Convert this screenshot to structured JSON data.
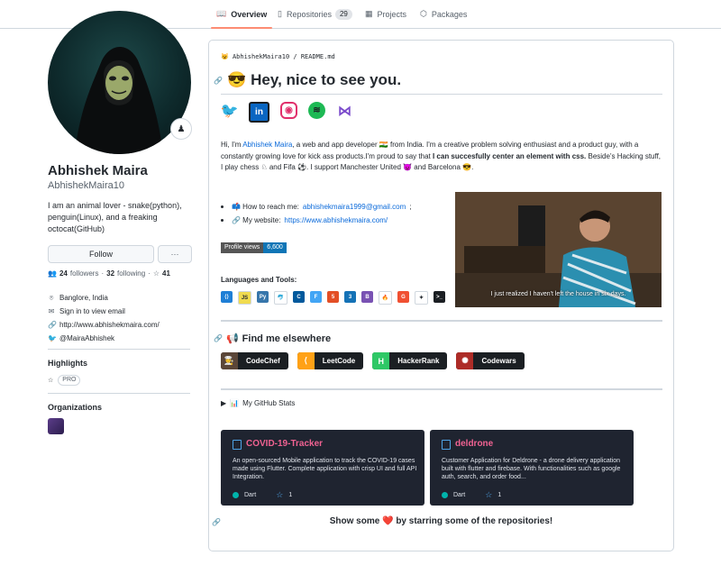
{
  "tabs": [
    {
      "label": "Overview",
      "icon": "book-icon"
    },
    {
      "label": "Repositories",
      "icon": "repo-icon",
      "count": "29"
    },
    {
      "label": "Projects",
      "icon": "project-icon"
    },
    {
      "label": "Packages",
      "icon": "package-icon"
    }
  ],
  "profile": {
    "name": "Abhishek Maira",
    "login": "AbhishekMaira10",
    "bio": "I am an animal lover - snake(python), penguin(Linux), and a freaking octocat(GitHub)",
    "follow_label": "Follow",
    "more_label": "···",
    "followers": "24",
    "followers_label": "followers",
    "following": "32",
    "following_label": "following",
    "stars": "41",
    "location": "Banglore, India",
    "email": "Sign in to view email",
    "website": "http://www.abhishekmaira.com/",
    "twitter": "@MairaAbhishek"
  },
  "highlights": {
    "title": "Highlights",
    "pro_label": "PRO"
  },
  "organizations": {
    "title": "Organizations"
  },
  "readme": {
    "path_user": "AbhishekMaira10",
    "path_sep": "/",
    "path_file": "README.md",
    "heading_emoji": "😎",
    "heading": "Hey, nice to see you.",
    "socials": [
      "twitter-icon",
      "linkedin-icon",
      "instagram-icon",
      "spotify-icon",
      "visualstudio-icon"
    ],
    "intro_1": "Hi, I'm ",
    "intro_name": "Abhishek Maira",
    "intro_2": ", a web and app developer 🇮🇳 from India. I'm a creative problem solving enthusiast and a product guy, with a constantly growing love for kick ass products.I'm proud to say that ",
    "intro_bold": "I can succesfully center an element with css.",
    "intro_3": " Beside's Hacking stuff, I play chess ♘ and Fifa ⚽. I support Manchester United 😈 and Barcelona 😎.",
    "reach_label": "📫 How to reach me: ",
    "reach_email": "abhishekmaira1999@gmail.com",
    "reach_end": ";",
    "website_label": "🔗 My website: ",
    "website_url": "https://www.abhishekmaira.com/",
    "views_label": "Profile views",
    "views_count": "6,600",
    "gif_caption": "I just realized I haven't left the house in six days.",
    "tools_title": "Languages and Tools:",
    "tools": [
      {
        "icon": "vscode-icon",
        "text": "⟨⟩",
        "color": "#1f7fd6"
      },
      {
        "icon": "javascript-icon",
        "text": "JS",
        "color": "#f0db4f"
      },
      {
        "icon": "python-icon",
        "text": "Py",
        "color": "#3776ab"
      },
      {
        "icon": "mysql-icon",
        "text": "🐬",
        "color": "#ffffff"
      },
      {
        "icon": "cplusplus-icon",
        "text": "C",
        "color": "#00599c"
      },
      {
        "icon": "flutter-icon",
        "text": "F",
        "color": "#42a5f5"
      },
      {
        "icon": "html5-icon",
        "text": "5",
        "color": "#e34f26"
      },
      {
        "icon": "css3-icon",
        "text": "3",
        "color": "#1572b6"
      },
      {
        "icon": "bootstrap-icon",
        "text": "B",
        "color": "#7952b3"
      },
      {
        "icon": "firebase-icon",
        "text": "🔥",
        "color": "#ffffff"
      },
      {
        "icon": "git-icon",
        "text": "G",
        "color": "#f05032"
      },
      {
        "icon": "figma-icon",
        "text": "✦",
        "color": "#ffffff"
      },
      {
        "icon": "terminal-icon",
        "text": ">_",
        "color": "#1b1f23"
      }
    ],
    "find_emoji": "📢",
    "find_title": "Find me elsewhere",
    "badges": [
      {
        "label": "CodeChef",
        "icon": "codechef-icon",
        "color": "#5b4638",
        "glyph": "👨‍🍳"
      },
      {
        "label": "LeetCode",
        "icon": "leetcode-icon",
        "color": "#ffa116",
        "glyph": "⟨"
      },
      {
        "label": "HackerRank",
        "icon": "hackerrank-icon",
        "color": "#2ec866",
        "glyph": "H"
      },
      {
        "label": "Codewars",
        "icon": "codewars-icon",
        "color": "#ad2c27",
        "glyph": "✺"
      }
    ],
    "stats_emoji": "📊",
    "stats_label": "My GitHub Stats",
    "cards": [
      {
        "title": "COVID-19-Tracker",
        "desc": "An open-sourced Mobile application to track the COVID-19 cases made using Flutter. Complete application with crisp UI and full API Integration.",
        "lang": "Dart",
        "stars": "1"
      },
      {
        "title": "deldrone",
        "desc": "Customer Application for Deldrone - a drone delivery application built with flutter and firebase. With functionalities such as google auth, search, and order food...",
        "lang": "Dart",
        "stars": "1"
      }
    ],
    "footer_1": "Show some ",
    "footer_heart": "❤️",
    "footer_2": " by starring some of the repositories!"
  }
}
